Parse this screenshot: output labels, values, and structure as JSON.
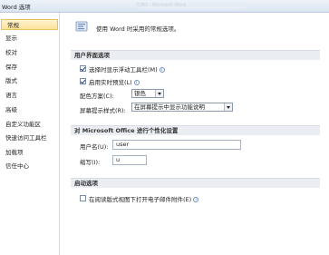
{
  "window": {
    "title": "Word 选项",
    "ghost_title": "文档1 - Microsoft Word"
  },
  "sidebar": {
    "items": [
      {
        "label": "常规",
        "selected": true
      },
      {
        "label": "显示"
      },
      {
        "label": "校对"
      },
      {
        "label": "保存"
      },
      {
        "label": "版式"
      },
      {
        "label": "语言"
      },
      {
        "label": "高级"
      },
      {
        "label": "自定义功能区"
      },
      {
        "label": "快速访问工具栏"
      },
      {
        "label": "加载项"
      },
      {
        "label": "信任中心"
      }
    ]
  },
  "main": {
    "intro": "使用 Word 时采用的常规选项。",
    "ui_section": {
      "title": "用户界面选项",
      "show_mini_toolbar": {
        "label": "选择时显示浮动工具栏(M)",
        "checked": true
      },
      "live_preview": {
        "label": "启用实时预览(L)",
        "checked": true
      },
      "color_scheme": {
        "label": "配色方案(C):",
        "value": "银色"
      },
      "screentip_style": {
        "label": "屏幕提示样式(R):",
        "value": "在屏幕提示中显示功能说明"
      }
    },
    "personalize_section": {
      "title": "对 Microsoft Office 进行个性化设置",
      "username": {
        "label": "用户名(U):",
        "value": "user"
      },
      "initials": {
        "label": "缩写(I):",
        "value": "u"
      }
    },
    "startup_section": {
      "title": "启动选项",
      "open_reading": {
        "label": "在阅读版式视图下打开电子邮件附件(E)",
        "checked": false
      }
    }
  },
  "colors": {
    "selected_bg": "#fde29a",
    "section_bg": "#eaeef3",
    "accent": "#3f67a8"
  }
}
